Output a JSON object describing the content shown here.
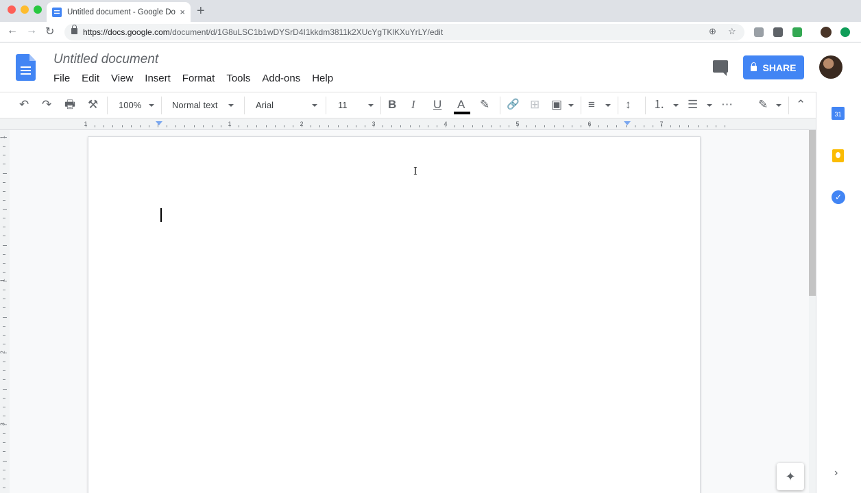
{
  "browser": {
    "tab_title": "Untitled document - Google Docs",
    "tab_close": "×",
    "new_tab": "+",
    "url_host": "https://docs.google.com",
    "url_path": "/document/d/1G8uLSC1b1wDYSrD4I1kkdm3811k2XUcYgTKlKXuYrLY/edit",
    "back": "←",
    "forward": "→",
    "reload": "↻",
    "zoom_icon": "⊕",
    "star_icon": "☆"
  },
  "docs": {
    "title": "Untitled document",
    "menu": [
      "File",
      "Edit",
      "View",
      "Insert",
      "Format",
      "Tools",
      "Add-ons",
      "Help"
    ],
    "share_label": "SHARE"
  },
  "toolbar": {
    "undo": "↶",
    "redo": "↷",
    "print": "🖶",
    "paint_format": "⚒",
    "zoom": "100%",
    "style": "Normal text",
    "font": "Arial",
    "font_size": "11",
    "bold": "B",
    "italic": "I",
    "underline": "U",
    "text_color": "A",
    "highlight": "✎",
    "link": "🔗",
    "comment": "⊞",
    "image": "▣",
    "align": "≡",
    "line_spacing": "↕",
    "numbered_list": "⒈",
    "bulleted_list": "☰",
    "more": "⋯",
    "editing_mode": "✎",
    "collapse": "⌃"
  },
  "ruler": {
    "numbers": [
      "1",
      "1",
      "2",
      "3",
      "4",
      "5",
      "6",
      "7"
    ]
  },
  "vruler": {
    "numbers": [
      "1",
      "1",
      "2",
      "3"
    ]
  },
  "sidepanel": {
    "calendar_label": "31",
    "tasks_label": "✓",
    "expand": "›"
  },
  "explore": "✦",
  "colors": {
    "accent": "#4285f4",
    "keep": "#fbbc04"
  }
}
